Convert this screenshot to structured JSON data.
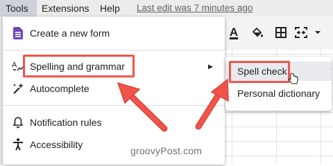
{
  "menubar": {
    "items": [
      "Tools",
      "Extensions",
      "Help"
    ],
    "last_edit": "Last edit was 7 minutes ago"
  },
  "toolbar": {
    "text_color_glyph": "A",
    "icons": [
      "text-color-icon",
      "fill-color-icon",
      "borders-icon",
      "merge-cells-icon",
      "chevron-down-icon"
    ]
  },
  "tools_menu": {
    "items": [
      {
        "label": "Create a new form",
        "icon": "form-icon"
      },
      {
        "label": "Spelling and grammar",
        "icon": "spellcheck-icon",
        "has_submenu": true
      },
      {
        "label": "Autocomplete",
        "icon": "magic-wand-icon"
      },
      {
        "label": "Notification rules",
        "icon": "bell-icon"
      },
      {
        "label": "Accessibility",
        "icon": "accessibility-icon"
      }
    ]
  },
  "submenu": {
    "items": [
      "Spell check",
      "Personal dictionary"
    ]
  },
  "annotation": {
    "highlight_color": "#f1544b",
    "arrow_color": "#f1544b"
  },
  "watermark": "groovyPost.com"
}
